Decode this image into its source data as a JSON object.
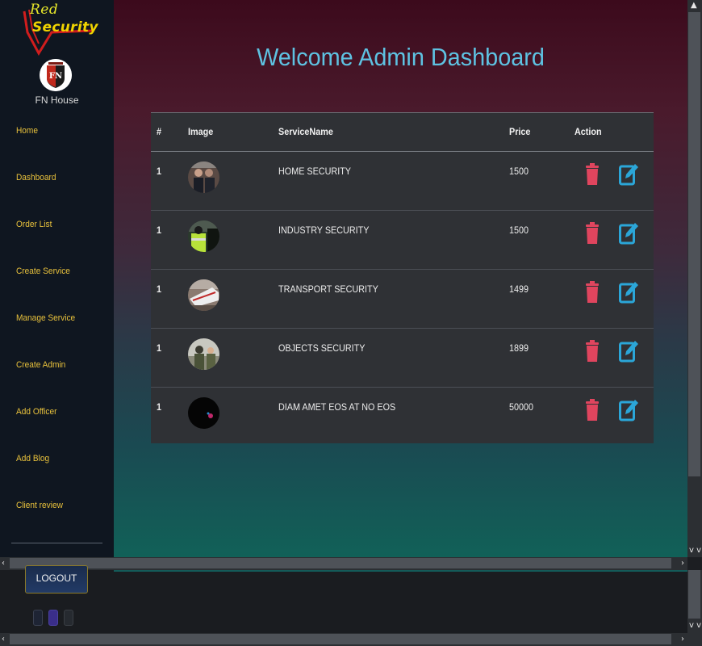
{
  "brand": {
    "line1": "Red",
    "line2": "Security",
    "house_name": "FN House"
  },
  "sidebar": {
    "items": [
      {
        "label": "Home"
      },
      {
        "label": "Dashboard"
      },
      {
        "label": "Order List"
      },
      {
        "label": "Create Service"
      },
      {
        "label": "Manage Service"
      },
      {
        "label": "Create Admin"
      },
      {
        "label": "Add Officer"
      },
      {
        "label": "Add Blog"
      },
      {
        "label": "Client review"
      }
    ],
    "logout_label": "LOGOUT"
  },
  "main": {
    "title": "Welcome Admin Dashboard"
  },
  "table": {
    "headers": {
      "num": "#",
      "image": "Image",
      "service": "ServiceName",
      "price": "Price",
      "action": "Action"
    },
    "rows": [
      {
        "num": "1",
        "service": "HOME SECURITY",
        "price": "1500",
        "image_icon": "guards-photo-icon"
      },
      {
        "num": "1",
        "service": "INDUSTRY SECURITY",
        "price": "1500",
        "image_icon": "vest-officer-photo-icon"
      },
      {
        "num": "1",
        "service": "TRANSPORT SECURITY",
        "price": "1499",
        "image_icon": "train-photo-icon"
      },
      {
        "num": "1",
        "service": "OBJECTS SECURITY",
        "price": "1899",
        "image_icon": "soldier-photo-icon"
      },
      {
        "num": "1",
        "service": "DIAM AMET EOS AT NO EOS",
        "price": "50000",
        "image_icon": "dark-photo-icon"
      }
    ]
  },
  "colors": {
    "delete": "#e0455e",
    "edit": "#2ba6d8",
    "title": "#5ec2e2",
    "nav": "#e9c23c"
  }
}
